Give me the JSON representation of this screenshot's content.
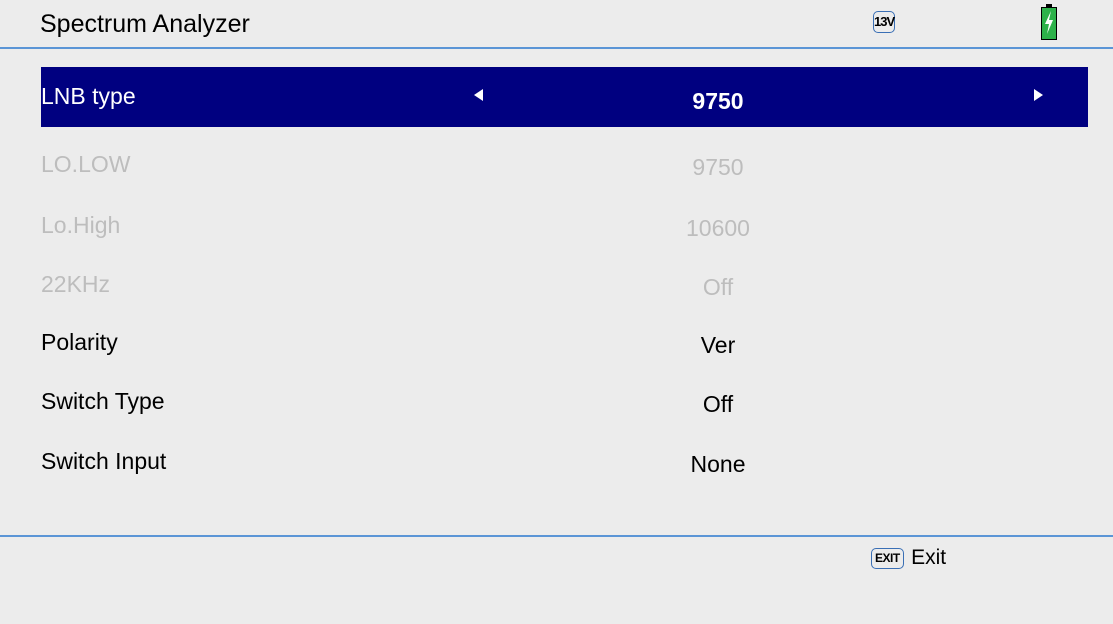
{
  "header": {
    "title": "Spectrum Analyzer",
    "voltage_badge": "13V",
    "battery_icon": "battery-charging-icon"
  },
  "menu": [
    {
      "label": "LNB type",
      "value": "9750",
      "state": "selected"
    },
    {
      "label": "LO.LOW",
      "value": "9750",
      "state": "disabled"
    },
    {
      "label": "Lo.High",
      "value": "10600",
      "state": "disabled"
    },
    {
      "label": "22KHz",
      "value": "Off",
      "state": "disabled"
    },
    {
      "label": "Polarity",
      "value": "Ver",
      "state": "normal"
    },
    {
      "label": "Switch Type",
      "value": "Off",
      "state": "normal"
    },
    {
      "label": "Switch Input",
      "value": "None",
      "state": "normal"
    }
  ],
  "footer": {
    "exit_key": "EXIT",
    "exit_label": "Exit"
  },
  "colors": {
    "background": "#ececec",
    "selection": "#000080",
    "rule": "#5b95d6",
    "disabled_text": "#bdbdbd",
    "battery": "#2db24a"
  }
}
